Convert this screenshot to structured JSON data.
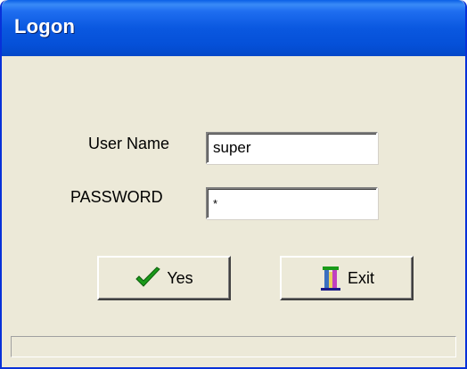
{
  "window": {
    "title": "Logon"
  },
  "form": {
    "username_label": "User Name",
    "username_value": "super",
    "password_label": "PASSWORD",
    "password_value": "*"
  },
  "buttons": {
    "yes_label": "Yes",
    "yes_icon": "checkmark-icon",
    "exit_label": "Exit",
    "exit_icon": "exit-door-icon"
  },
  "colors": {
    "titlebar": "#0a58e0",
    "window_bg": "#ece9d8",
    "check_green": "#1a9a1a"
  }
}
